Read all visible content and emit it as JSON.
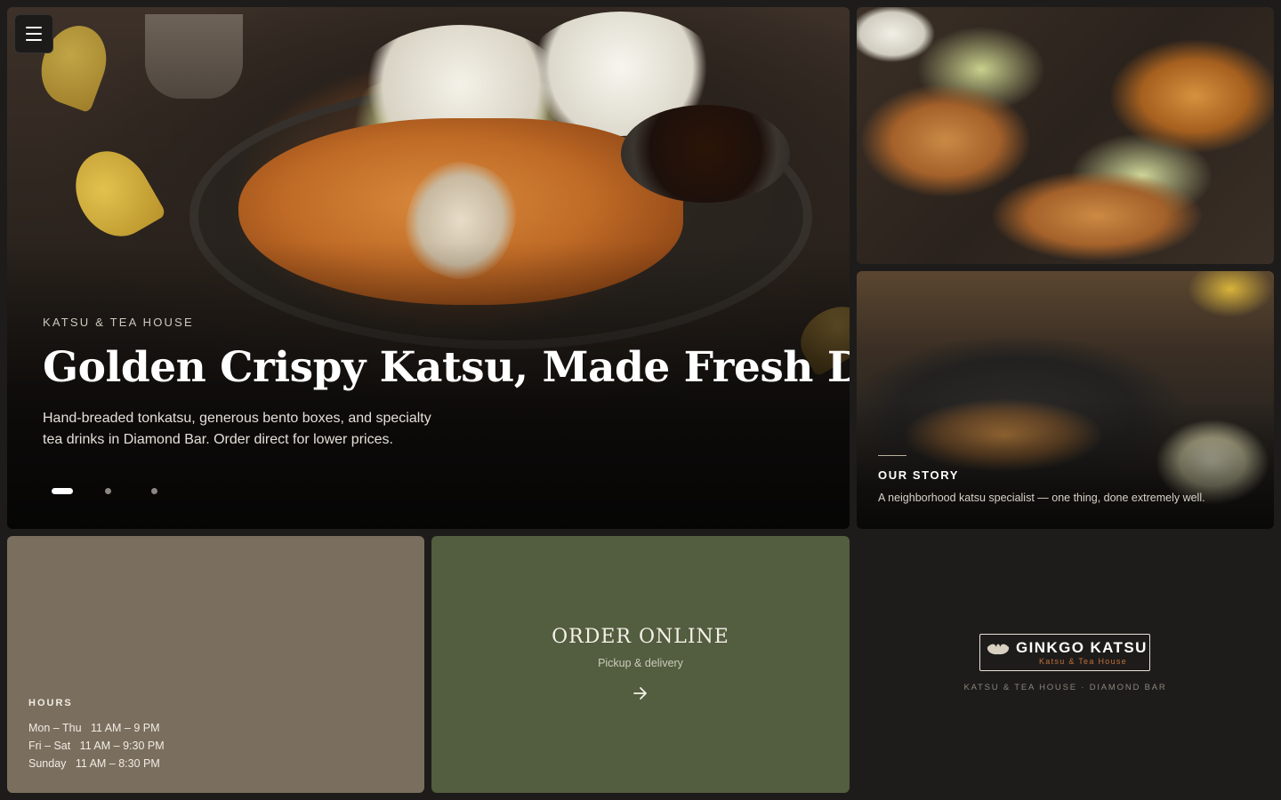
{
  "hero": {
    "eyebrow": "KATSU & TEA HOUSE",
    "title": "Golden Crispy Katsu, Made Fresh Daily",
    "description": "Hand-breaded tonkatsu, generous bento boxes, and specialty tea drinks in Diamond Bar. Order direct for lower prices.",
    "slides": {
      "count": 3,
      "active": 1
    }
  },
  "menu_button": {
    "icon": "hamburger-menu-icon"
  },
  "story": {
    "title": "OUR STORY",
    "description": "A neighborhood katsu specialist — one thing, done extremely well."
  },
  "hours": {
    "title": "HOURS",
    "rows": [
      {
        "days": "Mon – Thu",
        "time": "11 AM – 9 PM"
      },
      {
        "days": "Fri – Sat",
        "time": "11 AM – 9:30 PM"
      },
      {
        "days": "Sunday",
        "time": "11 AM – 8:30 PM"
      }
    ]
  },
  "order": {
    "title": "ORDER ONLINE",
    "subtitle": "Pickup & delivery",
    "icon": "arrow-right-icon"
  },
  "brand": {
    "name": "GINKGO KATSU",
    "tagline": "Katsu & Tea House",
    "caption": "KATSU & TEA HOUSE · DIAMOND BAR",
    "icon": "ginkgo-leaf-icon",
    "accent_color": "#c1703a"
  },
  "colors": {
    "background": "#1d1c1a",
    "hours_tile": "#7a6e5e",
    "order_tile": "#535d3f"
  }
}
